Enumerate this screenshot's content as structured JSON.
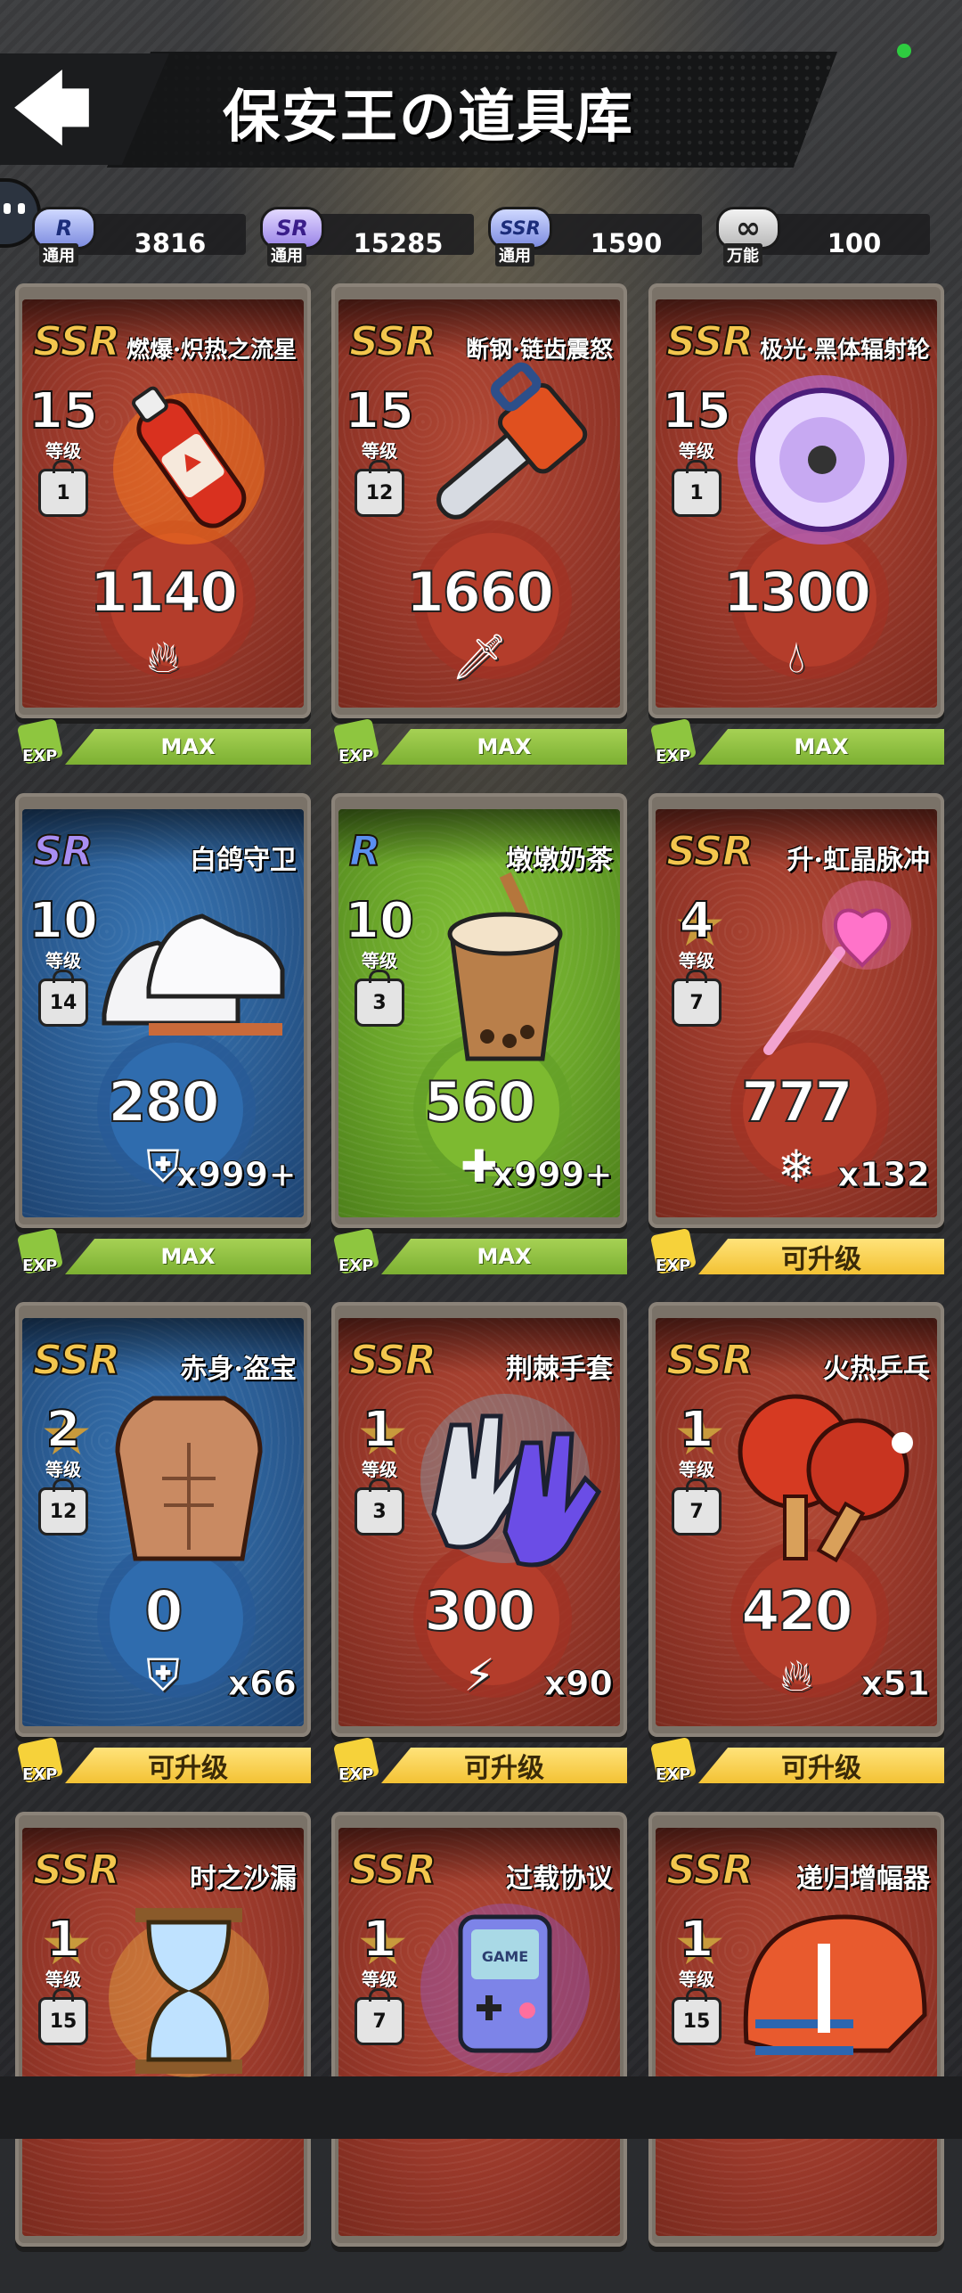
{
  "header": {
    "title": "保安王の道具库",
    "back_icon": "back-arrow-icon"
  },
  "currencies": [
    {
      "badge": "R",
      "label": "通用",
      "value": "3816"
    },
    {
      "badge": "SR",
      "label": "通用",
      "value": "15285"
    },
    {
      "badge": "SSR",
      "label": "通用",
      "value": "1590"
    },
    {
      "badge": "∞",
      "label": "万能",
      "value": "100"
    }
  ],
  "cards": [
    {
      "rarity": "SSR",
      "name": "燃爆·炽热之流星",
      "level": "15",
      "level_label": "等级",
      "weight": "1",
      "stat": "1140",
      "stat_icon": "fire-icon",
      "count": "",
      "status": "MAX",
      "exp": "EXP",
      "theme": "red",
      "item": "soda-bottle"
    },
    {
      "rarity": "SSR",
      "name": "断钢·链齿震怒",
      "level": "15",
      "level_label": "等级",
      "weight": "12",
      "stat": "1660",
      "stat_icon": "sword-icon",
      "count": "",
      "status": "MAX",
      "exp": "EXP",
      "theme": "red",
      "item": "chainsaw"
    },
    {
      "rarity": "SSR",
      "name": "极光·黑体辐射轮",
      "level": "15",
      "level_label": "等级",
      "weight": "1",
      "stat": "1300",
      "stat_icon": "splash-icon",
      "count": "",
      "status": "MAX",
      "exp": "EXP",
      "theme": "red",
      "item": "disc"
    },
    {
      "rarity": "SR",
      "name": "白鸽守卫",
      "level": "10",
      "level_label": "等级",
      "weight": "14",
      "stat": "280",
      "stat_icon": "shield-icon",
      "count": "x999+",
      "status": "MAX",
      "exp": "EXP",
      "theme": "blue",
      "item": "sneakers"
    },
    {
      "rarity": "R",
      "name": "墩墩奶茶",
      "level": "10",
      "level_label": "等级",
      "weight": "3",
      "stat": "560",
      "stat_icon": "plus-icon",
      "count": "x999+",
      "status": "MAX",
      "exp": "EXP",
      "theme": "green",
      "item": "milk-tea"
    },
    {
      "rarity": "SSR",
      "name": "升·虹晶脉冲",
      "level": "4",
      "level_label": "等级",
      "weight": "7",
      "stat": "777",
      "stat_icon": "snowflake-icon",
      "count": "x132",
      "status": "可升级",
      "exp": "EXP",
      "theme": "red",
      "item": "magic-wand"
    },
    {
      "rarity": "SSR",
      "name": "赤身·盗宝",
      "level": "2",
      "level_label": "等级",
      "weight": "12",
      "stat": "0",
      "stat_icon": "shield-icon",
      "count": "x66",
      "status": "可升级",
      "exp": "EXP",
      "theme": "blue",
      "item": "torso"
    },
    {
      "rarity": "SSR",
      "name": "荆棘手套",
      "level": "1",
      "level_label": "等级",
      "weight": "3",
      "stat": "300",
      "stat_icon": "lightning-icon",
      "count": "x90",
      "status": "可升级",
      "exp": "EXP",
      "theme": "red",
      "item": "gloves"
    },
    {
      "rarity": "SSR",
      "name": "火热乒乓",
      "level": "1",
      "level_label": "等级",
      "weight": "7",
      "stat": "420",
      "stat_icon": "fire-icon",
      "count": "x51",
      "status": "可升级",
      "exp": "EXP",
      "theme": "red",
      "item": "paddles"
    },
    {
      "rarity": "SSR",
      "name": "时之沙漏",
      "level": "1",
      "level_label": "等级",
      "weight": "15",
      "stat": "",
      "stat_icon": "",
      "count": "",
      "status": "",
      "exp": "",
      "theme": "red",
      "item": "hourglass"
    },
    {
      "rarity": "SSR",
      "name": "过载协议",
      "level": "1",
      "level_label": "等级",
      "weight": "7",
      "stat": "",
      "stat_icon": "",
      "count": "",
      "status": "",
      "exp": "",
      "theme": "red",
      "item": "game-console"
    },
    {
      "rarity": "SSR",
      "name": "递归增幅器",
      "level": "1",
      "level_label": "等级",
      "weight": "15",
      "stat": "",
      "stat_icon": "",
      "count": "",
      "status": "",
      "exp": "",
      "theme": "red",
      "item": "helmet"
    }
  ],
  "colors": {
    "ssr": "#f3c64e",
    "sr": "#a98ef2",
    "r": "#5a8ff0",
    "max_bar": "#8ec63f",
    "upgrade_bar": "#f6d23a"
  }
}
